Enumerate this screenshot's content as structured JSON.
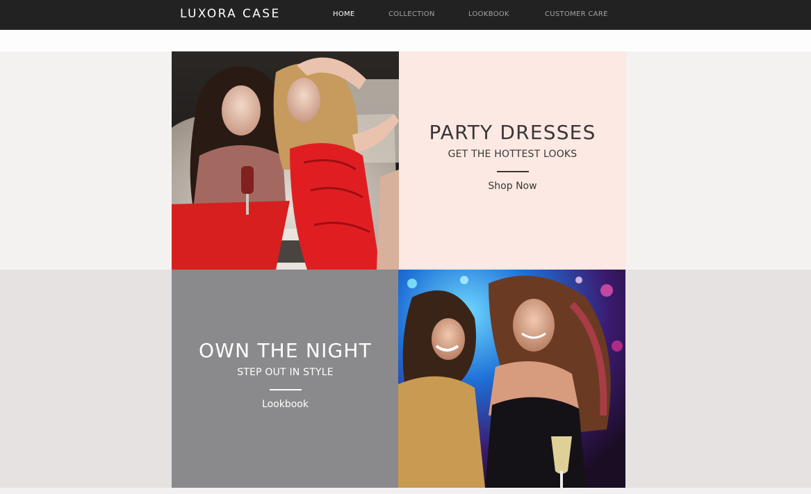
{
  "brand": {
    "name": "LUXORA CASE"
  },
  "nav": {
    "items": [
      {
        "label": "HOME",
        "active": true
      },
      {
        "label": "COLLECTION",
        "active": false
      },
      {
        "label": "LOOKBOOK",
        "active": false
      },
      {
        "label": "CUSTOMER CARE",
        "active": false
      }
    ]
  },
  "tiles": {
    "party": {
      "title": "PARTY DRESSES",
      "subtitle": "GET THE HOTTEST LOOKS",
      "link": "Shop Now"
    },
    "night": {
      "title": "OWN THE NIGHT",
      "subtitle": "STEP OUT IN STYLE",
      "link": "Lookbook"
    },
    "photo_top": {
      "icon": "party-photo-image"
    },
    "photo_bottom": {
      "icon": "dance-photo-image"
    }
  },
  "colors": {
    "header_bg": "#222222",
    "party_tile_bg": "#fce9e3",
    "night_tile_bg": "#8a898b",
    "band_light": "#f4f2f1",
    "band_dark": "#e6e2e1"
  }
}
